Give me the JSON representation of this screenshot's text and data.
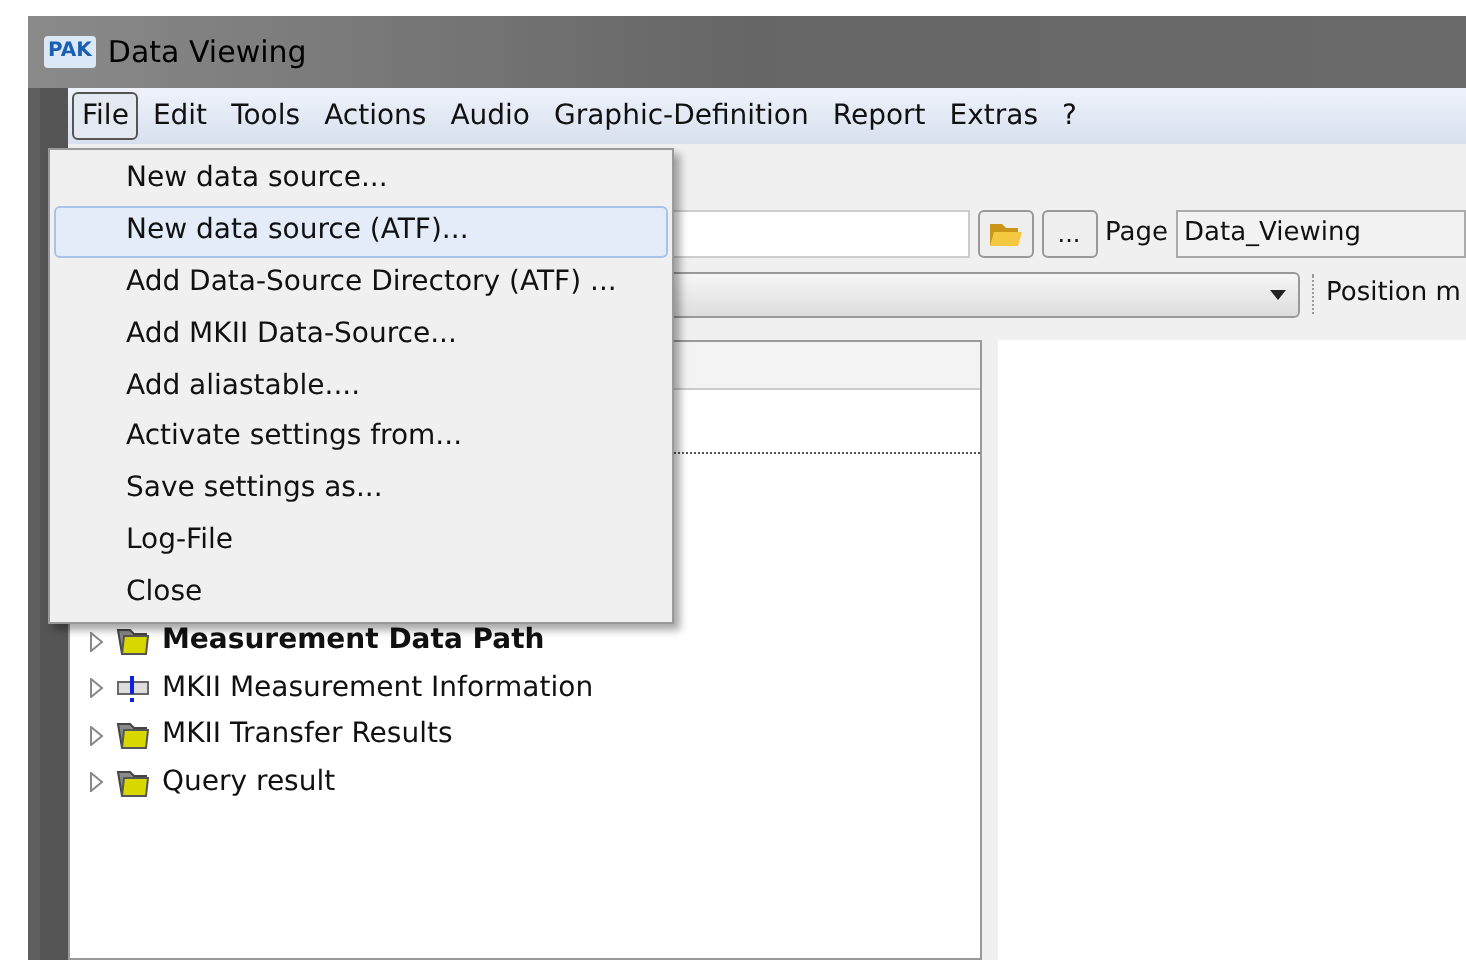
{
  "window": {
    "title": "Data Viewing",
    "logo": "PAK"
  },
  "menu_bar": [
    {
      "label": "File",
      "selected": true
    },
    {
      "label": "Edit",
      "selected": false
    },
    {
      "label": "Tools",
      "selected": false
    },
    {
      "label": "Actions",
      "selected": false
    },
    {
      "label": "Audio",
      "selected": false
    },
    {
      "label": "Graphic-Definition",
      "selected": false
    },
    {
      "label": "Report",
      "selected": false
    },
    {
      "label": "Extras",
      "selected": false
    },
    {
      "label": "?",
      "selected": false
    }
  ],
  "file_menu": [
    {
      "label": "New data source...",
      "selected": false
    },
    {
      "label": "New data source (ATF)...",
      "selected": true
    },
    {
      "label": "Add Data-Source Directory (ATF) ...",
      "selected": false
    },
    {
      "label": "Add MKII Data-Source...",
      "selected": false
    },
    {
      "label": "Add aliastable....",
      "selected": false
    },
    {
      "label": "Activate settings from...",
      "selected": false
    },
    {
      "label": "Save settings as...",
      "selected": false
    },
    {
      "label": "Log-File",
      "selected": false
    },
    {
      "label": "Close",
      "selected": false
    }
  ],
  "toolbar": {
    "browse_button": "...",
    "page_label": "Page",
    "page_value": "Data_Viewing",
    "position_label": "Position m"
  },
  "tree": [
    {
      "label": "Measurement Data Path",
      "kind": "folder",
      "bold": true
    },
    {
      "label": "MKII Measurement Information",
      "kind": "info",
      "bold": false
    },
    {
      "label": "MKII Transfer Results",
      "kind": "folder",
      "bold": false
    },
    {
      "label": "Query result",
      "kind": "folder",
      "bold": false
    }
  ]
}
